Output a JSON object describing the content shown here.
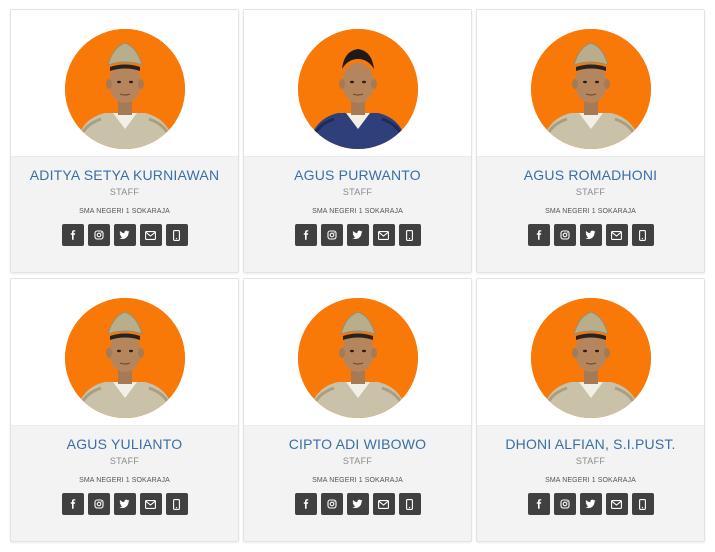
{
  "colors": {
    "accent": "#f97908",
    "name": "#3a6ea8",
    "button": "#404040",
    "card_bg": "#f3f3f3"
  },
  "social_icons": [
    "facebook-icon",
    "instagram-icon",
    "twitter-icon",
    "email-icon",
    "phone-icon"
  ],
  "staff": [
    {
      "name": "ADITYA SETYA KURNIAWAN",
      "role": "STAFF",
      "school": "SMA NEGERI 1 SOKARAJA",
      "uniform": "khaki"
    },
    {
      "name": "AGUS PURWANTO",
      "role": "STAFF",
      "school": "SMA NEGERI 1 SOKARAJA",
      "uniform": "navy"
    },
    {
      "name": "AGUS ROMADHONI",
      "role": "STAFF",
      "school": "SMA NEGERI 1 SOKARAJA",
      "uniform": "khaki"
    },
    {
      "name": "AGUS YULIANTO",
      "role": "STAFF",
      "school": "SMA NEGERI 1 SOKARAJA",
      "uniform": "khaki"
    },
    {
      "name": "CIPTO ADI WIBOWO",
      "role": "STAFF",
      "school": "SMA NEGERI 1 SOKARAJA",
      "uniform": "khaki"
    },
    {
      "name": "DHONI ALFIAN, S.I.PUST.",
      "role": "STAFF",
      "school": "SMA NEGERI 1 SOKARAJA",
      "uniform": "khaki"
    }
  ]
}
